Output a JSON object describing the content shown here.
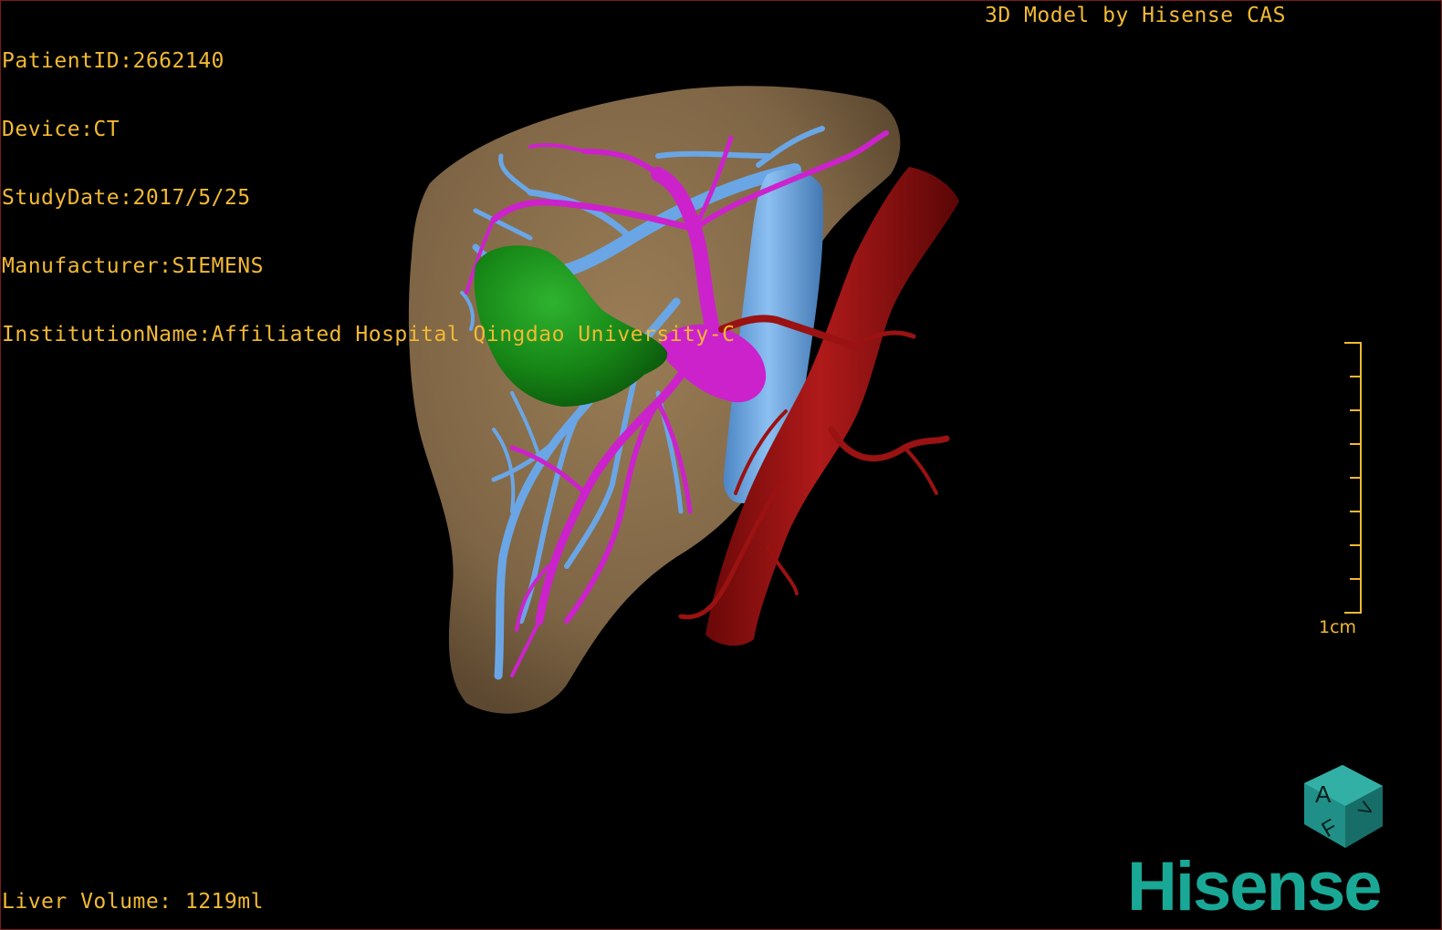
{
  "overlay": {
    "patient_id": "PatientID:2662140",
    "device": "Device:CT",
    "study_date": "StudyDate:2017/5/25",
    "manufacturer": "Manufacturer:SIEMENS",
    "institution": "InstitutionName:Affiliated Hospital Qingdao University-C",
    "credit": "3D Model by Hisense CAS",
    "liver_volume": "Liver Volume: 1219ml"
  },
  "scale": {
    "label": "1cm"
  },
  "orientation_cube": {
    "face_front": "A",
    "face_side": "F",
    "face_top": "V"
  },
  "brand": {
    "logo_text": "Hisense"
  },
  "colors": {
    "overlay_text": "#f2b933",
    "liver": "#8a7150",
    "portal_vein": "#6aa6e6",
    "hepatic_artery": "#cc22cc",
    "gallbladder": "#1a8a1a",
    "aorta": "#9a1212",
    "brand": "#19a896"
  }
}
